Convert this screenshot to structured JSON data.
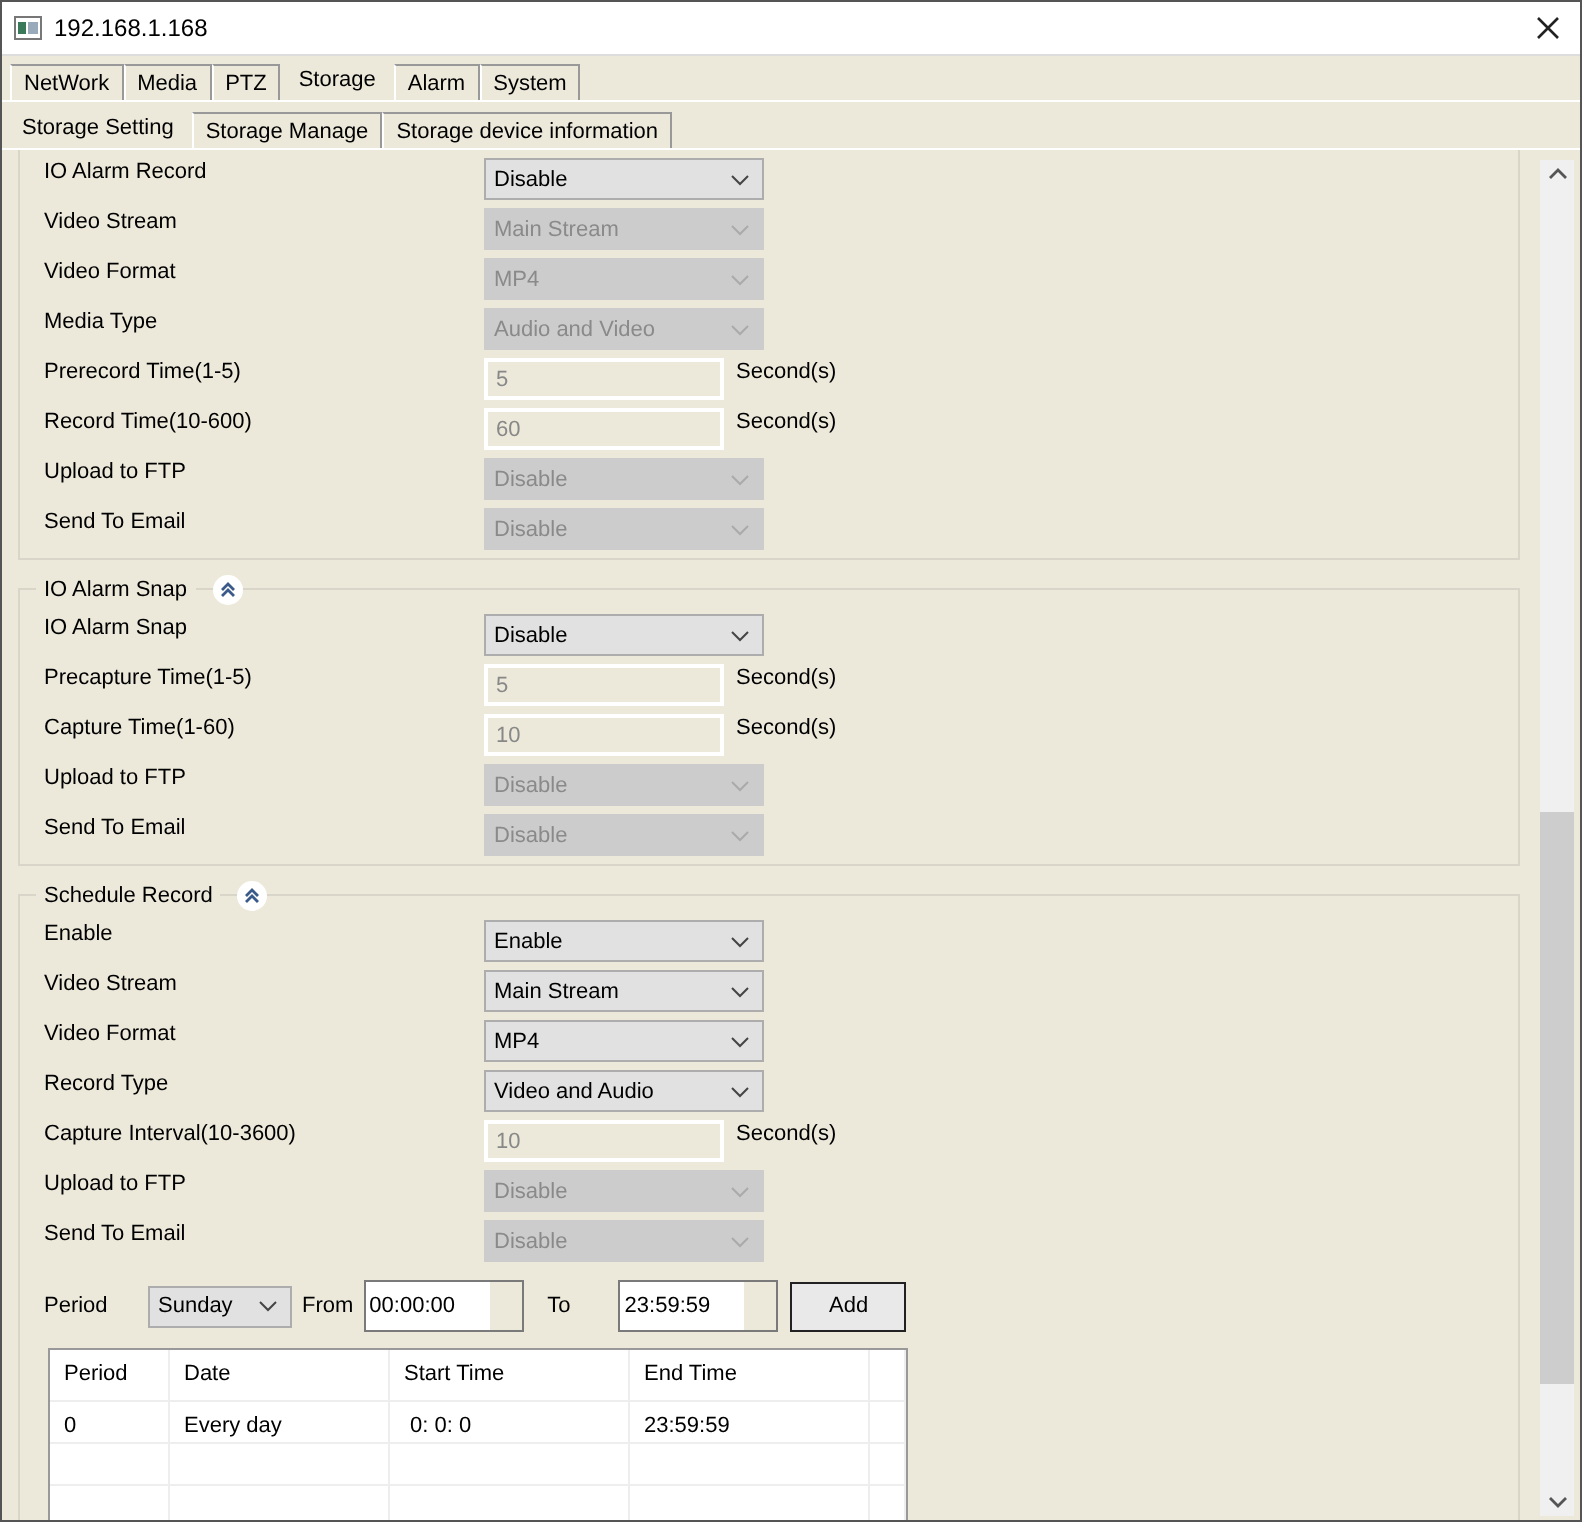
{
  "window": {
    "title": "192.168.1.168"
  },
  "tabs": [
    {
      "label": "NetWork",
      "selected": false
    },
    {
      "label": "Media",
      "selected": false
    },
    {
      "label": "PTZ",
      "selected": false
    },
    {
      "label": "Storage",
      "selected": true
    },
    {
      "label": "Alarm",
      "selected": false
    },
    {
      "label": "System",
      "selected": false
    }
  ],
  "subtabs": [
    {
      "label": "Storage Setting",
      "selected": true
    },
    {
      "label": "Storage Manage",
      "selected": false
    },
    {
      "label": "Storage device information",
      "selected": false
    }
  ],
  "sections": [
    {
      "rows": [
        {
          "kind": "select",
          "label": "IO Alarm Record",
          "value": "Disable",
          "disabled": false
        },
        {
          "kind": "select",
          "label": "Video Stream",
          "value": "Main Stream",
          "disabled": true
        },
        {
          "kind": "select",
          "label": "Video Format",
          "value": "MP4",
          "disabled": true
        },
        {
          "kind": "select",
          "label": "Media Type",
          "value": "Audio and Video",
          "disabled": true
        },
        {
          "kind": "input",
          "label": "Prerecord Time(1-5)",
          "value": "5",
          "disabled": true,
          "unit": "Second(s)"
        },
        {
          "kind": "input",
          "label": "Record Time(10-600)",
          "value": "60",
          "disabled": true,
          "unit": "Second(s)"
        },
        {
          "kind": "select",
          "label": "Upload to FTP",
          "value": "Disable",
          "disabled": true
        },
        {
          "kind": "select",
          "label": "Send To Email",
          "value": "Disable",
          "disabled": true
        }
      ]
    },
    {
      "title": "IO Alarm Snap",
      "rows": [
        {
          "kind": "select",
          "label": "IO Alarm Snap",
          "value": "Disable",
          "disabled": false
        },
        {
          "kind": "input",
          "label": "Precapture Time(1-5)",
          "value": "5",
          "disabled": true,
          "unit": "Second(s)"
        },
        {
          "kind": "input",
          "label": "Capture Time(1-60)",
          "value": "10",
          "disabled": true,
          "unit": "Second(s)"
        },
        {
          "kind": "select",
          "label": "Upload to FTP",
          "value": "Disable",
          "disabled": true
        },
        {
          "kind": "select",
          "label": "Send To Email",
          "value": "Disable",
          "disabled": true
        }
      ]
    },
    {
      "title": "Schedule Record",
      "rows": [
        {
          "kind": "select",
          "label": "Enable",
          "value": "Enable",
          "disabled": false
        },
        {
          "kind": "select",
          "label": "Video Stream",
          "value": "Main Stream",
          "disabled": false
        },
        {
          "kind": "select",
          "label": "Video Format",
          "value": "MP4",
          "disabled": false
        },
        {
          "kind": "select",
          "label": "Record Type",
          "value": "Video and Audio",
          "disabled": false
        },
        {
          "kind": "input",
          "label": "Capture Interval(10-3600)",
          "value": "10",
          "disabled": true,
          "unit": "Second(s)"
        },
        {
          "kind": "select",
          "label": "Upload to FTP",
          "value": "Disable",
          "disabled": true
        },
        {
          "kind": "select",
          "label": "Send To Email",
          "value": "Disable",
          "disabled": true
        }
      ],
      "schedule": {
        "period_label": "Period",
        "day": "Sunday",
        "from_label": "From",
        "from": "00:00:00",
        "to_label": "To",
        "to": "23:59:59",
        "add_button": "Add",
        "table": {
          "columns": [
            "Period",
            "Date",
            "Start Time",
            "End Time"
          ],
          "rows": [
            [
              "0",
              "Every day",
              " 0: 0: 0",
              "23:59:59"
            ]
          ]
        }
      }
    }
  ]
}
